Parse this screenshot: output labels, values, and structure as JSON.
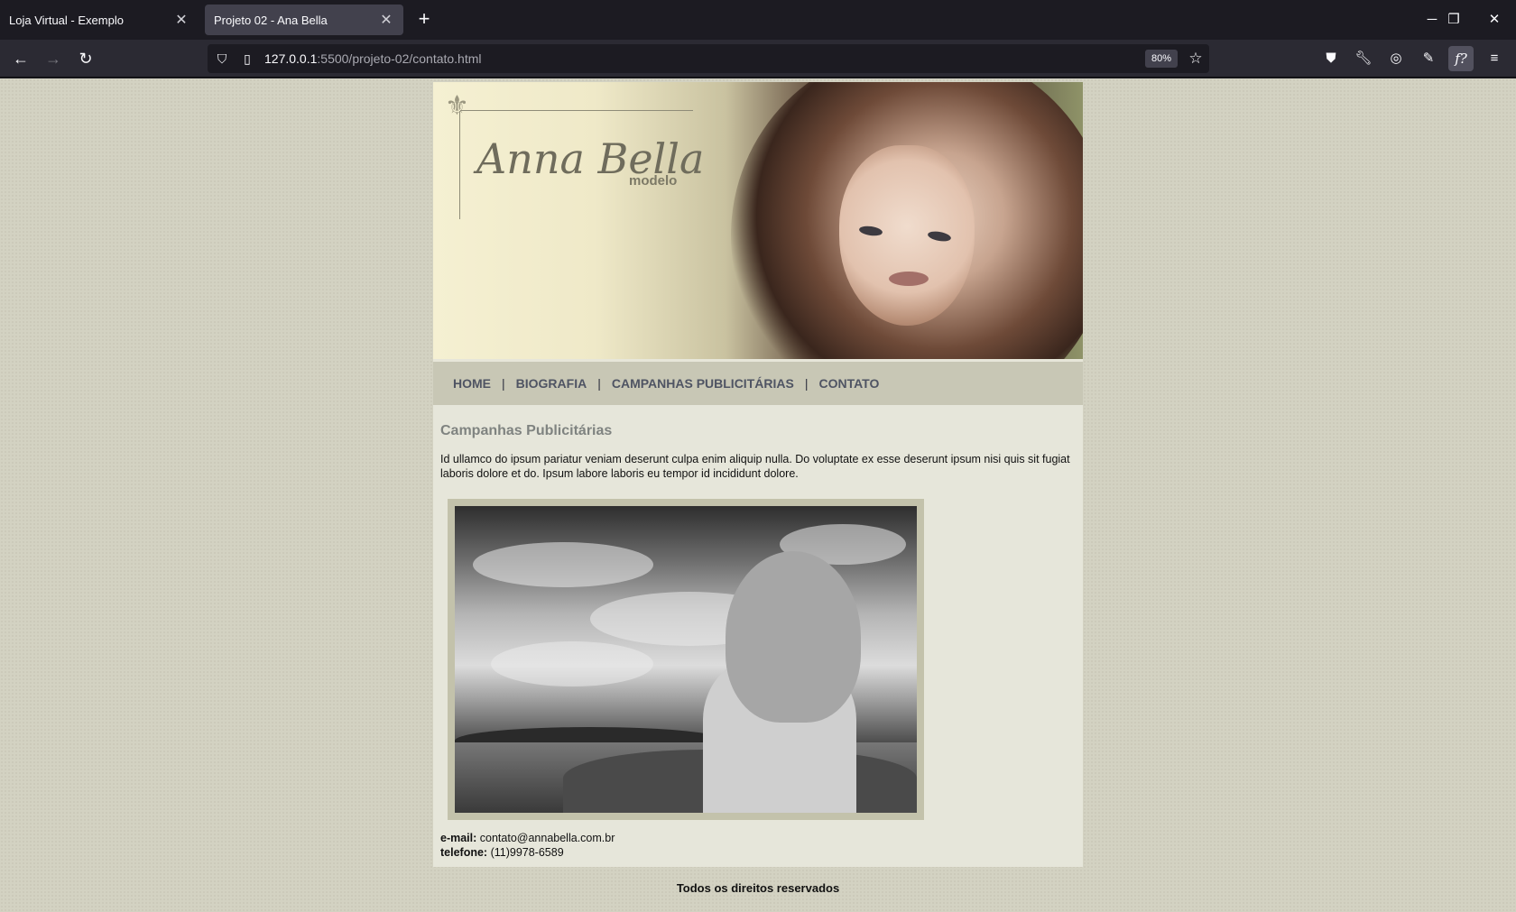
{
  "browser": {
    "tabs": [
      {
        "title": "Loja Virtual - Exemplo",
        "active": false
      },
      {
        "title": "Projeto 02 - Ana Bella",
        "active": true
      }
    ],
    "url": {
      "host": "127.0.0.1",
      "rest": ":5500/projeto-02/contato.html"
    },
    "zoom": "80%",
    "icons": {
      "back": "back-arrow-icon",
      "forward": "forward-arrow-icon",
      "reload": "reload-icon",
      "shield": "tracking-shield-icon",
      "page": "page-info-icon",
      "star": "bookmark-star-icon",
      "pocket": "pocket-icon",
      "wrench": "wrench-icon",
      "compass": "compass-icon",
      "pen": "eyedropper-icon",
      "fonts": "font-inspector-icon",
      "menu": "hamburger-menu-icon"
    }
  },
  "site": {
    "logo": {
      "script": "Anna Bella",
      "sub": "modelo"
    },
    "menu": [
      {
        "label": "HOME"
      },
      {
        "label": "BIOGRAFIA"
      },
      {
        "label": "CAMPANHAS PUBLICITÁRIAS"
      },
      {
        "label": "CONTATO"
      }
    ],
    "menu_separator": "|",
    "content": {
      "heading": "Campanhas Publicitárias",
      "paragraph": "Id ullamco do ipsum pariatur veniam deserunt culpa enim aliquip nulla. Do voluptate ex esse deserunt ipsum nisi quis sit fugiat laboris dolore et do. Ipsum labore laboris eu tempor id incididunt dolore.",
      "contact": {
        "email_label": "e-mail:",
        "email": "contato@annabella.com.br",
        "phone_label": "telefone:",
        "phone": "(11)9978-6589"
      }
    },
    "footer": "Todos os direitos reservados",
    "colors": {
      "page_bg": "#d3d2c2",
      "menu_bg": "#c8c7b5",
      "menu_text": "#4f5463",
      "content_bg": "#e6e6da",
      "heading": "#7f8380"
    }
  }
}
